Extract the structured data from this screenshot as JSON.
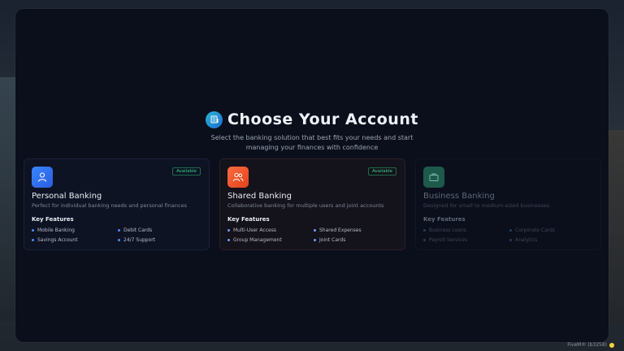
{
  "header": {
    "title": "Choose Your Account",
    "subtitle_line1": "Select the banking solution that best fits your needs and start",
    "subtitle_line2": "managing your finances with confidence"
  },
  "cards": [
    {
      "title": "Personal Banking",
      "description": "Perfect for individual banking needs and personal finances",
      "badge": "Available",
      "key_features_label": "Key Features",
      "features": [
        "Mobile Banking",
        "Debit Cards",
        "Savings Account",
        "24/7 Support"
      ],
      "icon": "user-icon",
      "accent": "#3a86ff"
    },
    {
      "title": "Shared Banking",
      "description": "Collaborative banking for multiple users and joint accounts",
      "badge": "Available",
      "key_features_label": "Key Features",
      "features": [
        "Multi-User Access",
        "Shared Expenses",
        "Group Management",
        "Joint Cards"
      ],
      "icon": "users-icon",
      "accent": "#ff6a3d"
    },
    {
      "title": "Business Banking",
      "description": "Designed for small to medium-sized businesses",
      "key_features_label": "Key Features",
      "features": [
        "Business Loans",
        "Corporate Cards",
        "Payroll Services",
        "Analytics"
      ],
      "icon": "briefcase-icon",
      "accent": "#1d5a4b"
    }
  ],
  "footer": {
    "tag": "FiveM® (b3258)"
  },
  "colors": {
    "panel_bg": "#0b0f1c",
    "available_green": "#3ccf8e"
  }
}
